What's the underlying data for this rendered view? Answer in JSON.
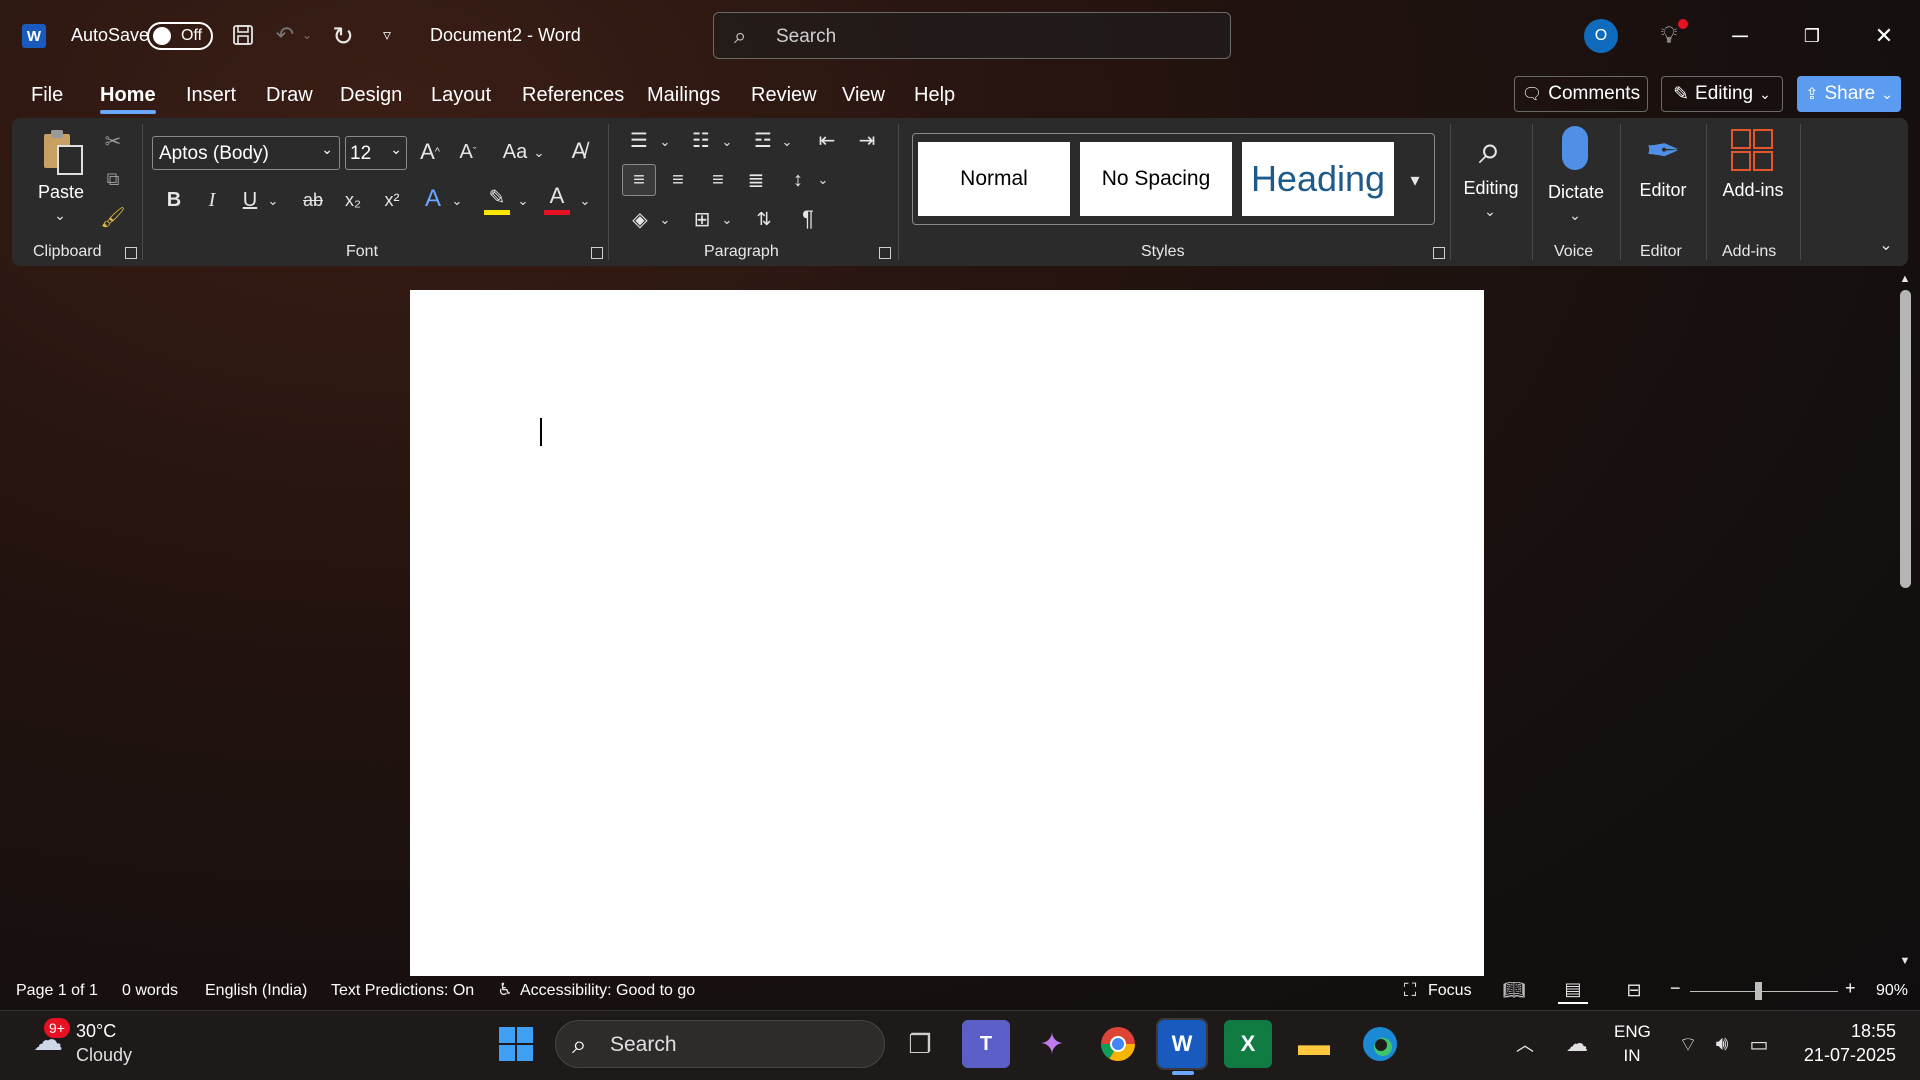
{
  "titlebar": {
    "app_icon": "word-logo-icon",
    "autosave_label": "AutoSave",
    "autosave_state": "Off",
    "doc_title": "Document2  -  Word",
    "search_placeholder": "Search",
    "avatar_initial": "O"
  },
  "menu": {
    "tabs": [
      "File",
      "Home",
      "Insert",
      "Draw",
      "Design",
      "Layout",
      "References",
      "Mailings",
      "Review",
      "View",
      "Help"
    ],
    "active_tab": "Home",
    "comments_label": "Comments",
    "editing_label": "Editing",
    "share_label": "Share"
  },
  "ribbon": {
    "clipboard": {
      "paste_label": "Paste",
      "group_label": "Clipboard"
    },
    "font": {
      "font_name": "Aptos (Body)",
      "font_size": "12",
      "case_label": "Aa",
      "bold": "B",
      "italic": "I",
      "underline": "U",
      "strike": "ab",
      "subscript": "x₂",
      "superscript": "x²",
      "group_label": "Font"
    },
    "paragraph": {
      "group_label": "Paragraph"
    },
    "styles": {
      "items": [
        "Normal",
        "No Spacing",
        "Heading"
      ],
      "group_label": "Styles"
    },
    "editing": {
      "label": "Editing"
    },
    "voice": {
      "label": "Dictate",
      "group_label": "Voice"
    },
    "editor": {
      "label": "Editor",
      "group_label": "Editor"
    },
    "addins": {
      "label": "Add-ins",
      "group_label": "Add-ins"
    }
  },
  "statusbar": {
    "page": "Page 1 of 1",
    "words": "0 words",
    "language": "English (India)",
    "predictions": "Text Predictions: On",
    "accessibility": "Accessibility: Good to go",
    "focus": "Focus",
    "zoom_minus": "−",
    "zoom_plus": "+",
    "zoom": "90%"
  },
  "taskbar": {
    "weather_badge": "9+",
    "weather_temp": "30°C",
    "weather_desc": "Cloudy",
    "search_placeholder": "Search",
    "lang_top": "ENG",
    "lang_bottom": "IN",
    "time": "18:55",
    "date": "21-07-2025"
  },
  "colors": {
    "accent": "#6aa8ff",
    "word_blue": "#185abd",
    "share_blue": "#5b9bf0",
    "highlight_yellow": "#ffe600",
    "font_red": "#e81123"
  }
}
